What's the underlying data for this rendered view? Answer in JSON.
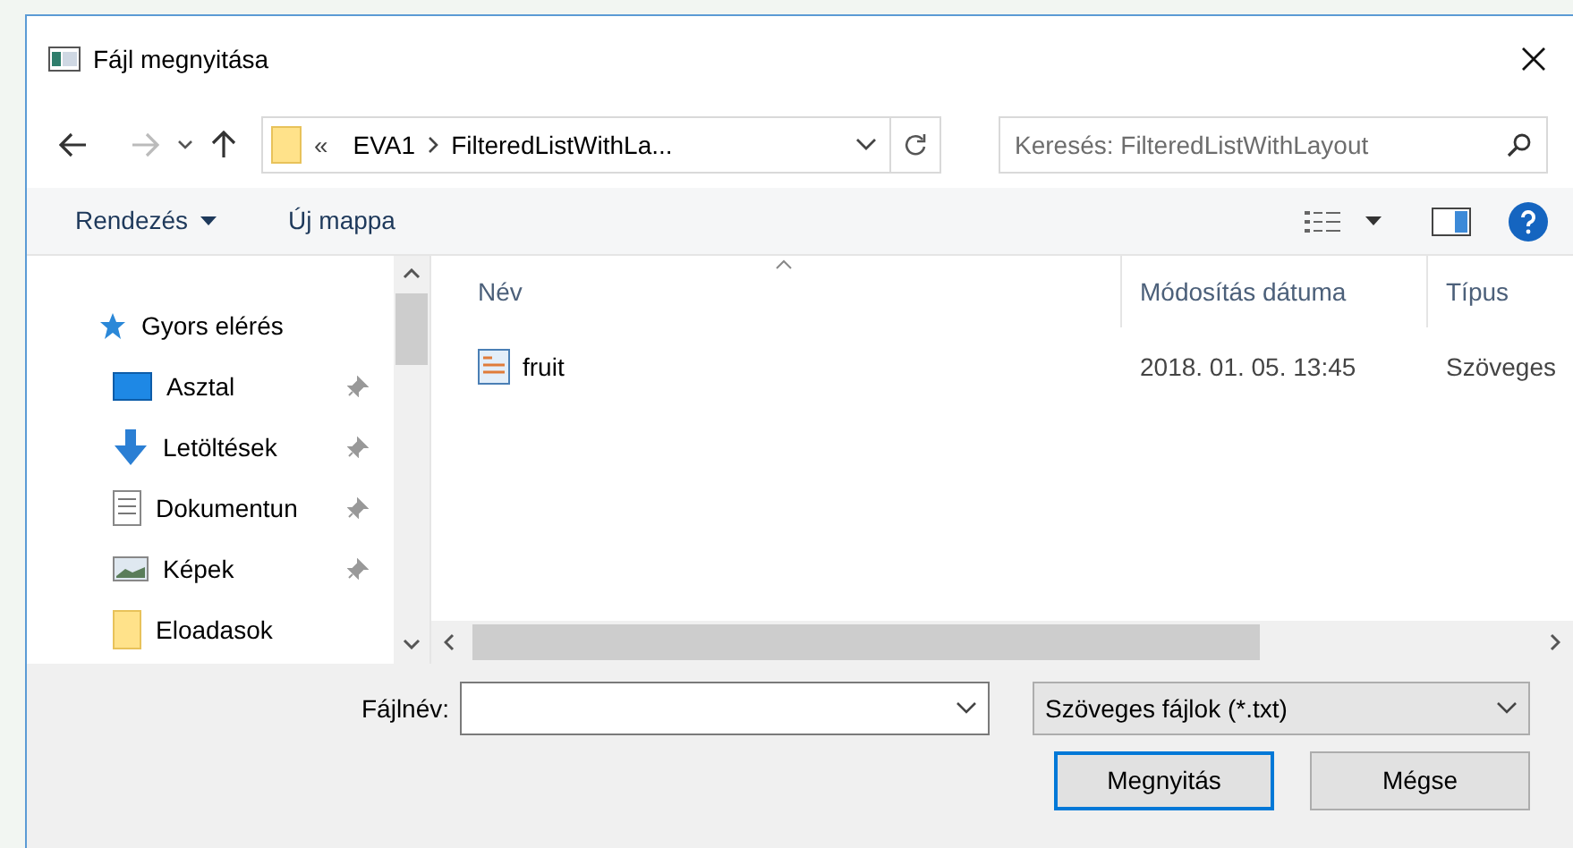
{
  "window": {
    "title": "Fájl megnyitása"
  },
  "address_bar": {
    "overflow": "«",
    "path": [
      "EVA1",
      "FilteredListWithLa..."
    ]
  },
  "search": {
    "placeholder": "Keresés: FilteredListWithLayout"
  },
  "toolbar": {
    "organize": "Rendezés",
    "new_folder": "Új mappa"
  },
  "sidebar": {
    "items": [
      {
        "label": "Gyors elérés",
        "kind": "star",
        "pinned": false,
        "header": true
      },
      {
        "label": "Asztal",
        "kind": "desktop",
        "pinned": true,
        "header": false
      },
      {
        "label": "Letöltések",
        "kind": "download",
        "pinned": true,
        "header": false
      },
      {
        "label": "Dokumentun",
        "kind": "document",
        "pinned": true,
        "header": false
      },
      {
        "label": "Képek",
        "kind": "pictures",
        "pinned": true,
        "header": false
      },
      {
        "label": "Eloadasok",
        "kind": "folder",
        "pinned": false,
        "header": false
      }
    ]
  },
  "table": {
    "columns": [
      "Név",
      "Módosítás dátuma",
      "Típus"
    ],
    "rows": [
      {
        "name": "fruit",
        "modified": "2018. 01. 05. 13:45",
        "type": "Szöveges"
      }
    ]
  },
  "filename": {
    "label": "Fájlnév:"
  },
  "file_type": {
    "value": "Szöveges fájlok (*.txt)"
  },
  "buttons": [
    {
      "label": "Megnyitás",
      "default": true
    },
    {
      "label": "Mégse",
      "default": false
    }
  ]
}
